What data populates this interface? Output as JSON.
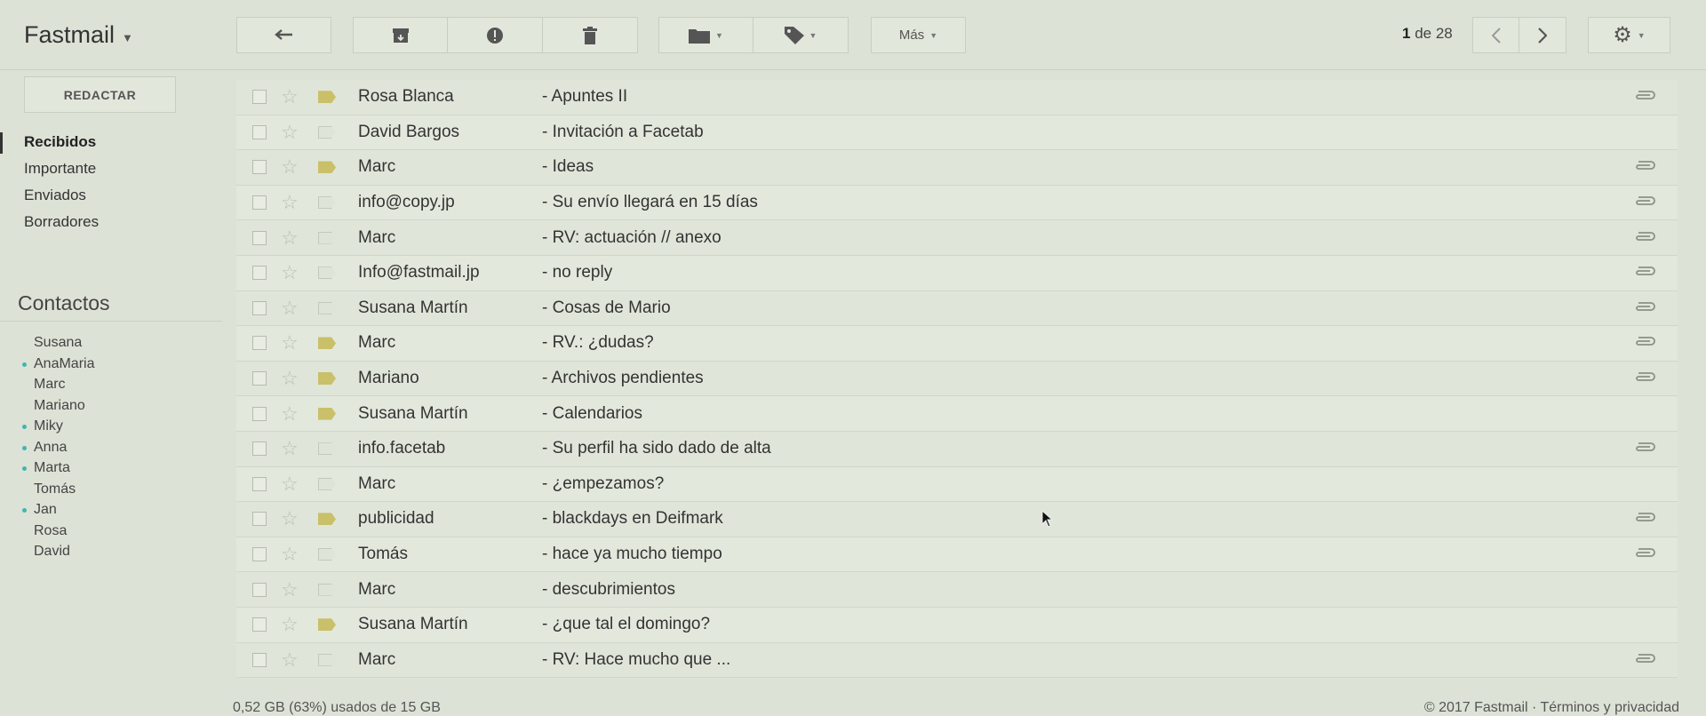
{
  "app": {
    "brand": "Fastmail"
  },
  "toolbar": {
    "more_label": "Más",
    "pager_current": "1",
    "pager_of": "de 28"
  },
  "sidebar": {
    "compose_label": "REDACTAR",
    "items": [
      {
        "label": "Recibidos",
        "active": true
      },
      {
        "label": "Importante",
        "active": false
      },
      {
        "label": "Enviados",
        "active": false
      },
      {
        "label": "Borradores",
        "active": false
      }
    ],
    "contacts_title": "Contactos",
    "contacts": [
      {
        "name": "Susana",
        "online": false
      },
      {
        "name": "AnaMaria",
        "online": true
      },
      {
        "name": "Marc",
        "online": false
      },
      {
        "name": "Mariano",
        "online": false
      },
      {
        "name": "Miky",
        "online": true
      },
      {
        "name": "Anna",
        "online": true
      },
      {
        "name": "Marta",
        "online": true
      },
      {
        "name": "Tomás",
        "online": false
      },
      {
        "name": "Jan",
        "online": true
      },
      {
        "name": "Rosa",
        "online": false
      },
      {
        "name": "David",
        "online": false
      }
    ]
  },
  "emails": [
    {
      "sender": "Rosa Blanca",
      "subject": "- Apuntes II",
      "important": true,
      "attachment": true
    },
    {
      "sender": "David Bargos",
      "subject": "- Invitación a Facetab",
      "important": false,
      "attachment": false
    },
    {
      "sender": "Marc",
      "subject": "- Ideas",
      "important": true,
      "attachment": true
    },
    {
      "sender": "info@copy.jp",
      "subject": "- Su envío llegará en 15 días",
      "important": false,
      "attachment": true
    },
    {
      "sender": "Marc",
      "subject": "- RV: actuación // anexo",
      "important": false,
      "attachment": true
    },
    {
      "sender": "Info@fastmail.jp",
      "subject": "- no reply",
      "important": false,
      "attachment": true
    },
    {
      "sender": "Susana Martín",
      "subject": "- Cosas de Mario",
      "important": false,
      "attachment": true
    },
    {
      "sender": "Marc",
      "subject": "- RV.: ¿dudas?",
      "important": true,
      "attachment": true
    },
    {
      "sender": "Mariano",
      "subject": "- Archivos pendientes",
      "important": true,
      "attachment": true
    },
    {
      "sender": "Susana Martín",
      "subject": "- Calendarios",
      "important": true,
      "attachment": false
    },
    {
      "sender": "info.facetab",
      "subject": "- Su perfil ha sido dado de alta",
      "important": false,
      "attachment": true
    },
    {
      "sender": "Marc",
      "subject": "- ¿empezamos?",
      "important": false,
      "attachment": false
    },
    {
      "sender": "publicidad",
      "subject": "- blackdays en Deifmark",
      "important": true,
      "attachment": true
    },
    {
      "sender": "Tomás",
      "subject": "- hace ya mucho tiempo",
      "important": false,
      "attachment": true
    },
    {
      "sender": "Marc",
      "subject": "- descubrimientos",
      "important": false,
      "attachment": false
    },
    {
      "sender": "Susana Martín",
      "subject": "- ¿que tal el domingo?",
      "important": true,
      "attachment": false
    },
    {
      "sender": "Marc",
      "subject": "- RV: Hace mucho que ...",
      "important": false,
      "attachment": true
    }
  ],
  "footer": {
    "storage": "0,52 GB (63%) usados de 15 GB",
    "copyright": "© 2017 Fastmail · Términos y privacidad"
  }
}
